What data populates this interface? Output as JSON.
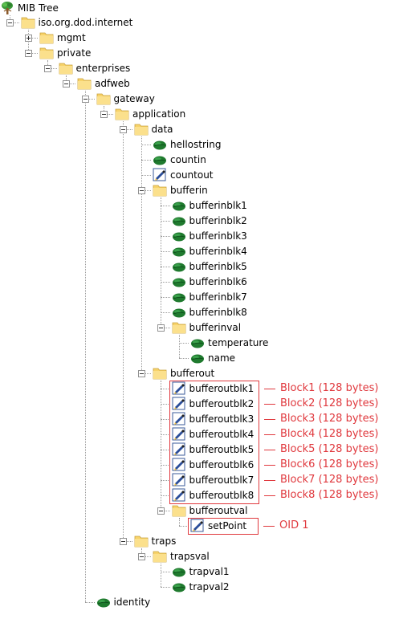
{
  "root": {
    "label": "MIB Tree",
    "icon": "tree-icon"
  },
  "nodes": [
    {
      "id": "iso",
      "label": "iso.org.dod.internet",
      "depth": 1,
      "icon": "folder-icon",
      "expander": "minus"
    },
    {
      "id": "mgmt",
      "label": "mgmt",
      "depth": 2,
      "icon": "folder-icon",
      "expander": "plus"
    },
    {
      "id": "private",
      "label": "private",
      "depth": 2,
      "icon": "folder-icon",
      "expander": "minus"
    },
    {
      "id": "enterprises",
      "label": "enterprises",
      "depth": 3,
      "icon": "folder-icon",
      "expander": "minus"
    },
    {
      "id": "adfweb",
      "label": "adfweb",
      "depth": 4,
      "icon": "folder-icon",
      "expander": "minus"
    },
    {
      "id": "gateway",
      "label": "gateway",
      "depth": 5,
      "icon": "folder-icon",
      "expander": "minus"
    },
    {
      "id": "application",
      "label": "application",
      "depth": 6,
      "icon": "folder-icon",
      "expander": "minus"
    },
    {
      "id": "data",
      "label": "data",
      "depth": 7,
      "icon": "folder-icon",
      "expander": "minus"
    },
    {
      "id": "hellostring",
      "label": "hellostring",
      "depth": 8,
      "icon": "leaf-icon"
    },
    {
      "id": "countin",
      "label": "countin",
      "depth": 8,
      "icon": "leaf-icon"
    },
    {
      "id": "countout",
      "label": "countout",
      "depth": 8,
      "icon": "writable-pen-icon"
    },
    {
      "id": "bufferin",
      "label": "bufferin",
      "depth": 8,
      "icon": "folder-icon",
      "expander": "minus"
    },
    {
      "id": "bufferinblk1",
      "label": "bufferinblk1",
      "depth": 9,
      "icon": "leaf-icon"
    },
    {
      "id": "bufferinblk2",
      "label": "bufferinblk2",
      "depth": 9,
      "icon": "leaf-icon"
    },
    {
      "id": "bufferinblk3",
      "label": "bufferinblk3",
      "depth": 9,
      "icon": "leaf-icon"
    },
    {
      "id": "bufferinblk4",
      "label": "bufferinblk4",
      "depth": 9,
      "icon": "leaf-icon"
    },
    {
      "id": "bufferinblk5",
      "label": "bufferinblk5",
      "depth": 9,
      "icon": "leaf-icon"
    },
    {
      "id": "bufferinblk6",
      "label": "bufferinblk6",
      "depth": 9,
      "icon": "leaf-icon"
    },
    {
      "id": "bufferinblk7",
      "label": "bufferinblk7",
      "depth": 9,
      "icon": "leaf-icon"
    },
    {
      "id": "bufferinblk8",
      "label": "bufferinblk8",
      "depth": 9,
      "icon": "leaf-icon"
    },
    {
      "id": "bufferinval",
      "label": "bufferinval",
      "depth": 9,
      "icon": "folder-icon",
      "expander": "minus"
    },
    {
      "id": "temperature",
      "label": "temperature",
      "depth": 10,
      "icon": "leaf-icon"
    },
    {
      "id": "name",
      "label": "name",
      "depth": 10,
      "icon": "leaf-icon"
    },
    {
      "id": "bufferout",
      "label": "bufferout",
      "depth": 8,
      "icon": "folder-icon",
      "expander": "minus"
    },
    {
      "id": "bufferoutblk1",
      "label": "bufferoutblk1",
      "depth": 9,
      "icon": "writable-pen-icon"
    },
    {
      "id": "bufferoutblk2",
      "label": "bufferoutblk2",
      "depth": 9,
      "icon": "writable-pen-icon"
    },
    {
      "id": "bufferoutblk3",
      "label": "bufferoutblk3",
      "depth": 9,
      "icon": "writable-pen-icon"
    },
    {
      "id": "bufferoutblk4",
      "label": "bufferoutblk4",
      "depth": 9,
      "icon": "writable-pen-icon"
    },
    {
      "id": "bufferoutblk5",
      "label": "bufferoutblk5",
      "depth": 9,
      "icon": "writable-pen-icon"
    },
    {
      "id": "bufferoutblk6",
      "label": "bufferoutblk6",
      "depth": 9,
      "icon": "writable-pen-icon"
    },
    {
      "id": "bufferoutblk7",
      "label": "bufferoutblk7",
      "depth": 9,
      "icon": "writable-pen-icon"
    },
    {
      "id": "bufferoutblk8",
      "label": "bufferoutblk8",
      "depth": 9,
      "icon": "writable-pen-icon"
    },
    {
      "id": "bufferoutval",
      "label": "bufferoutval",
      "depth": 9,
      "icon": "folder-icon",
      "expander": "minus"
    },
    {
      "id": "setPoint",
      "label": "setPoint",
      "depth": 10,
      "icon": "writable-pen-icon"
    },
    {
      "id": "traps",
      "label": "traps",
      "depth": 7,
      "icon": "folder-icon",
      "expander": "minus"
    },
    {
      "id": "trapsval",
      "label": "trapsval",
      "depth": 8,
      "icon": "folder-icon",
      "expander": "minus"
    },
    {
      "id": "trapval1",
      "label": "trapval1",
      "depth": 9,
      "icon": "leaf-icon"
    },
    {
      "id": "trapval2",
      "label": "trapval2",
      "depth": 9,
      "icon": "leaf-icon"
    },
    {
      "id": "identity",
      "label": "identity",
      "depth": 5,
      "icon": "leaf-icon"
    }
  ],
  "annotations": [
    {
      "node": "bufferoutblk1",
      "text": "Block1 (128 bytes)"
    },
    {
      "node": "bufferoutblk2",
      "text": "Block2 (128 bytes)"
    },
    {
      "node": "bufferoutblk3",
      "text": "Block3 (128 bytes)"
    },
    {
      "node": "bufferoutblk4",
      "text": "Block4 (128 bytes)"
    },
    {
      "node": "bufferoutblk5",
      "text": "Block5 (128 bytes)"
    },
    {
      "node": "bufferoutblk6",
      "text": "Block6 (128 bytes)"
    },
    {
      "node": "bufferoutblk7",
      "text": "Block7 (128 bytes)"
    },
    {
      "node": "bufferoutblk8",
      "text": "Block8 (128 bytes)"
    },
    {
      "node": "setPoint",
      "text": "OID 1"
    }
  ],
  "colors": {
    "annotation": "#e0393e",
    "folder": "#f7d36a",
    "leaf": "#1f7a2e",
    "tree_lines": "#9a9a9a"
  }
}
